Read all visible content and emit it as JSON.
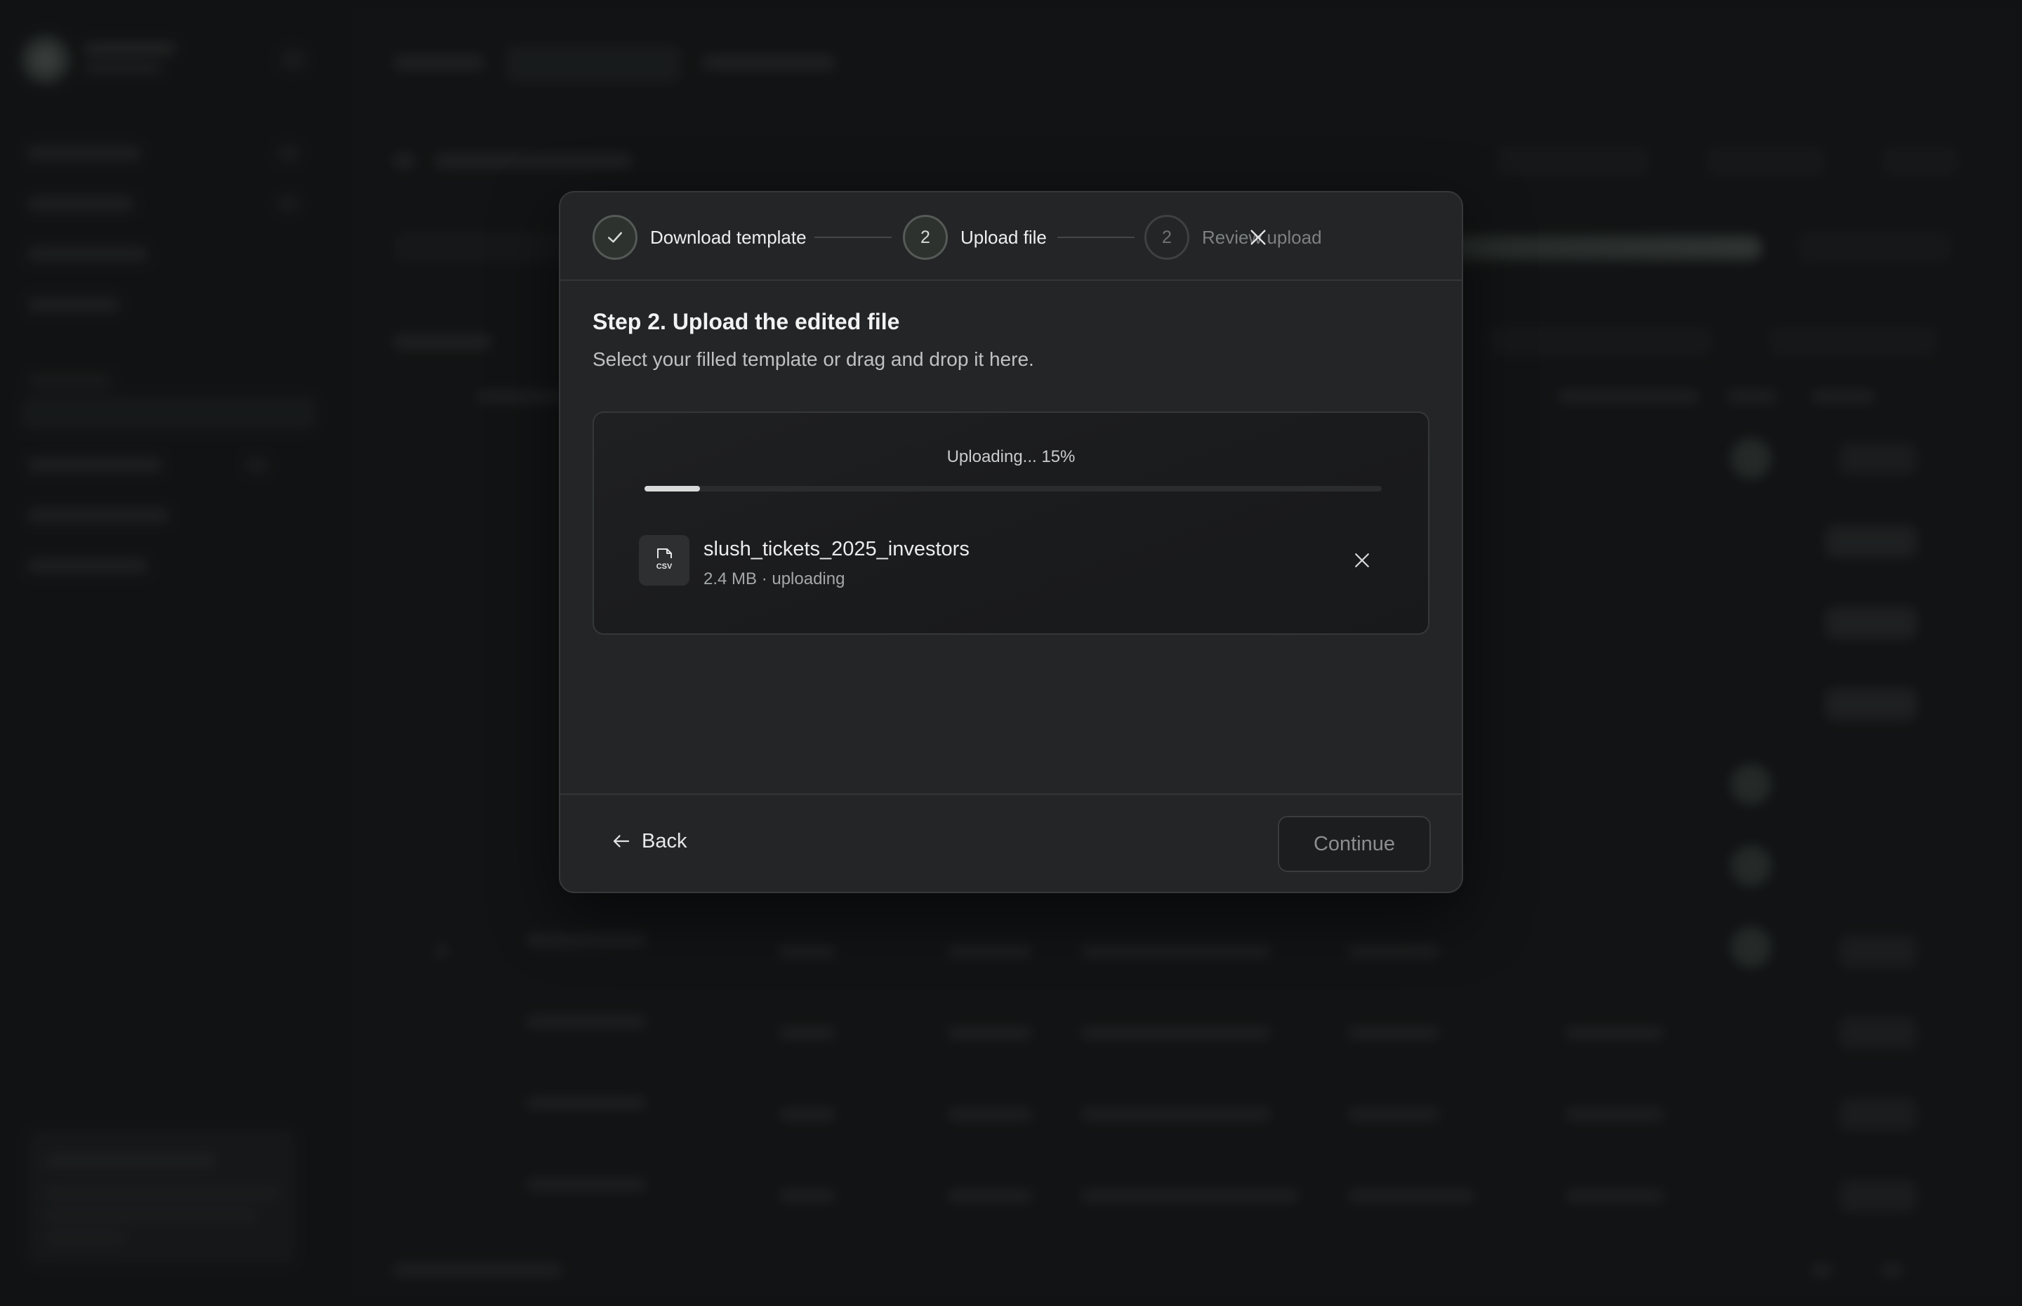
{
  "stepper": {
    "steps": [
      {
        "number": "",
        "label": "Download template",
        "state": "complete"
      },
      {
        "number": "2",
        "label": "Upload file",
        "state": "active"
      },
      {
        "number": "2",
        "label": "Review upload",
        "state": "pending"
      }
    ],
    "close_icon": "close-icon"
  },
  "content": {
    "title": "Step 2. Upload the edited file",
    "subtitle": "Select your filled template or drag and drop it here."
  },
  "upload": {
    "progress_text": "Uploading... 15%",
    "progress_fraction": 0.075,
    "file": {
      "type_badge": "CSV",
      "name": "slush_tickets_2025_investors",
      "meta": "2.4 MB · uploading",
      "remove_icon": "close-icon"
    }
  },
  "footer": {
    "back_label": "Back",
    "continue_label": "Continue",
    "continue_enabled": false
  },
  "colors": {
    "modal_bg": "#232527",
    "progress_fill": "#d8dad9",
    "accent_muted": "#555a57"
  }
}
